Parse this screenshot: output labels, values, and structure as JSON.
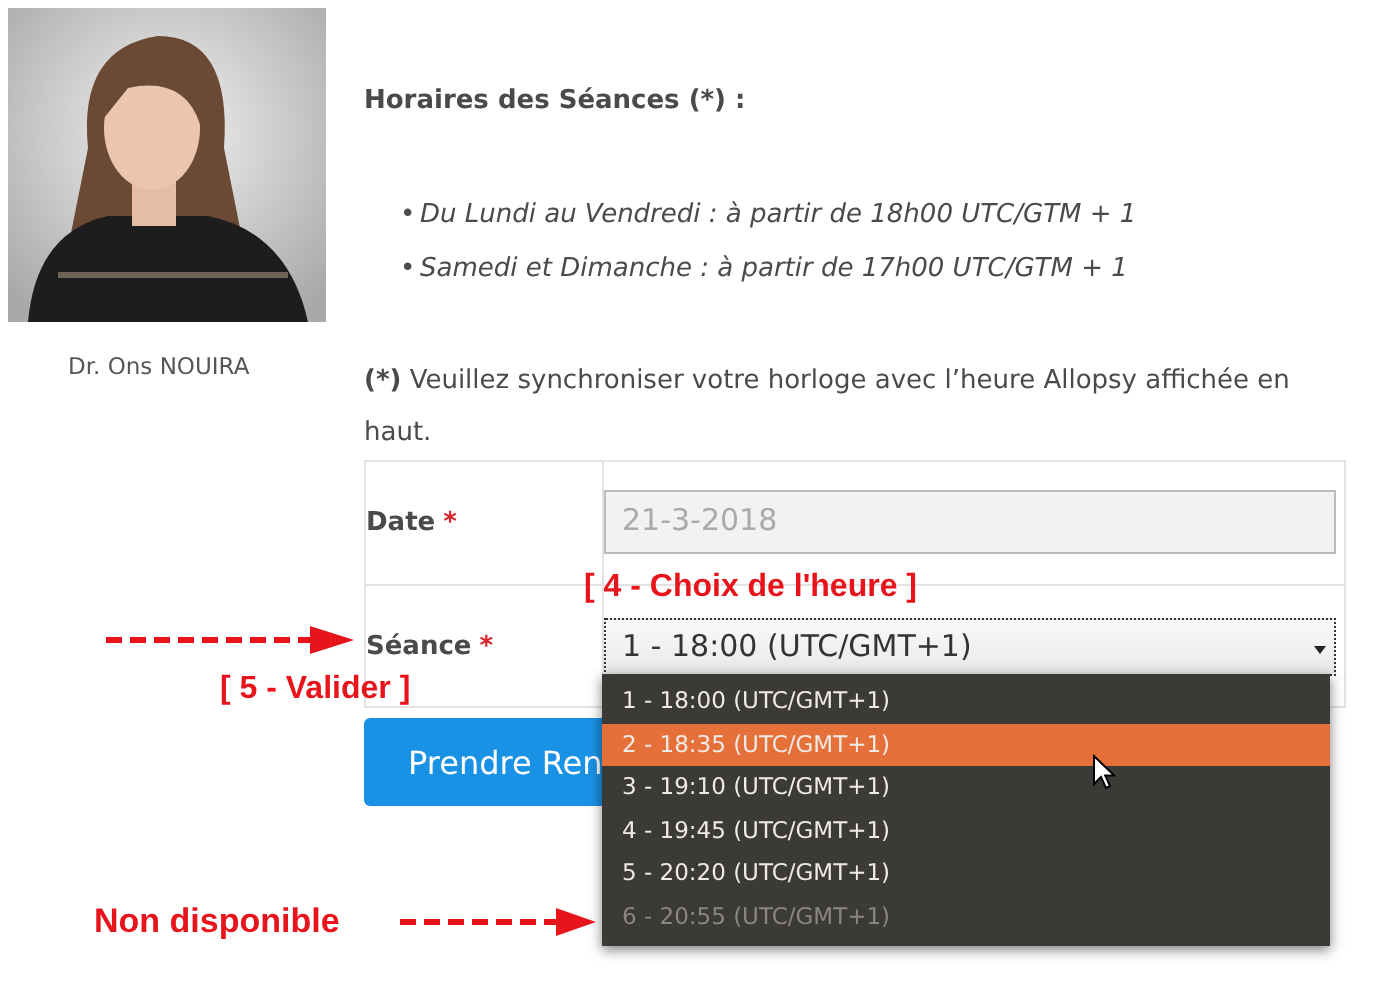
{
  "profile": {
    "name": "Dr. Ons NOUIRA"
  },
  "schedule": {
    "heading": "Horaires des Séances (*) :",
    "items": [
      {
        "marker": "•",
        "text": "Du Lundi au Vendredi : à partir de 18h00 UTC/GTM + 1"
      },
      {
        "marker": "•",
        "text": "Samedi et Dimanche : à partir de 17h00 UTC/GTM + 1"
      }
    ],
    "note": {
      "lead": "(*)",
      "text": "Veuillez synchroniser votre horloge avec l’heure Allopsy affichée en haut."
    }
  },
  "form": {
    "date": {
      "label": "Date",
      "required": "*",
      "value": "21-3-2018",
      "disabled": true
    },
    "session": {
      "label": "Séance",
      "required": "*",
      "value": "1 - 18:00 (UTC/GMT+1)",
      "expanded": true,
      "options": [
        {
          "label": "1 - 18:00 (UTC/GMT+1)",
          "highlighted": false,
          "disabled": false
        },
        {
          "label": "2 - 18:35 (UTC/GMT+1)",
          "highlighted": true,
          "disabled": false
        },
        {
          "label": "3 - 19:10 (UTC/GMT+1)",
          "highlighted": false,
          "disabled": false
        },
        {
          "label": "4 - 19:45 (UTC/GMT+1)",
          "highlighted": false,
          "disabled": false
        },
        {
          "label": "5 - 20:20 (UTC/GMT+1)",
          "highlighted": false,
          "disabled": false
        },
        {
          "label": "6 - 20:55 (UTC/GMT+1)",
          "highlighted": false,
          "disabled": true
        }
      ]
    },
    "submit": "Prendre Ren"
  },
  "annotations": [
    "[ 4 - Choix de l'heure ]",
    "[ 5 - Valider ]",
    "Non disponible"
  ]
}
